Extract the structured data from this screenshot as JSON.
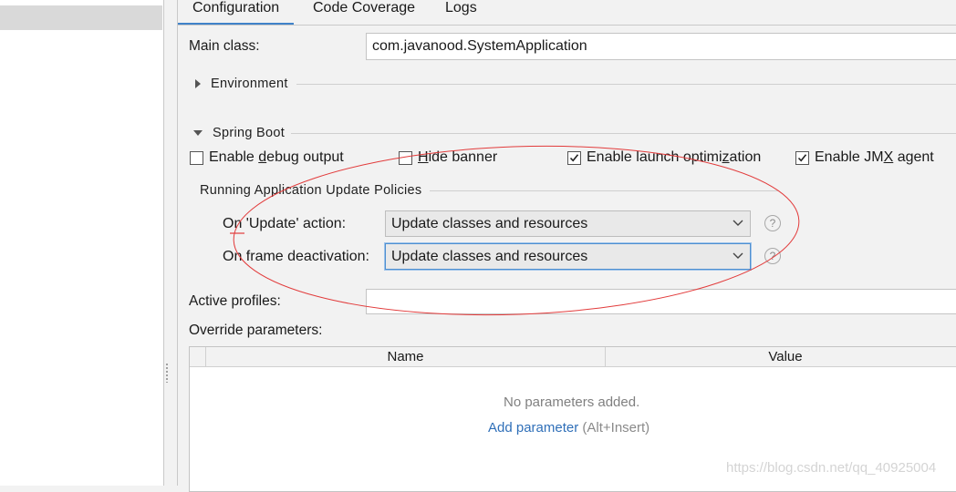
{
  "tabs": [
    {
      "label": "Configuration",
      "active": true
    },
    {
      "label": "Code Coverage",
      "active": false
    },
    {
      "label": "Logs",
      "active": false
    }
  ],
  "main_class": {
    "label": "Main class:",
    "value": "com.javanood.SystemApplication"
  },
  "environment": {
    "title": "Environment",
    "expanded": false
  },
  "spring_boot": {
    "title": "Spring Boot",
    "expanded": true,
    "checkboxes": [
      {
        "pre": "Enable ",
        "mnemonic": "d",
        "post": "ebug output",
        "checked": false
      },
      {
        "pre": "",
        "mnemonic": "H",
        "post": "ide banner",
        "checked": false
      },
      {
        "pre": "Enable launch optimi",
        "mnemonic": "z",
        "post": "ation",
        "checked": true
      },
      {
        "pre": "Enable JM",
        "mnemonic": "X",
        "post": " agent",
        "checked": true
      }
    ]
  },
  "update_policies": {
    "title": "Running Application Update Policies",
    "on_update": {
      "label": "On 'Update' action:",
      "value": "Update classes and resources"
    },
    "on_frame": {
      "label": "On frame deactivation:",
      "value": "Update classes and resources"
    }
  },
  "active_profiles": {
    "label": "Active profiles:",
    "value": ""
  },
  "override_params": {
    "label": "Override parameters:",
    "columns": [
      "Name",
      "Value"
    ],
    "empty_text": "No parameters added.",
    "add_link": "Add parameter",
    "add_shortcut": "(Alt+Insert)"
  },
  "watermark": "https://blog.csdn.net/qq_40925004",
  "colors": {
    "accent": "#4083c9",
    "annotation": "#e23b3b",
    "link": "#2f6fb8"
  },
  "icons": {
    "help": "question-circle-icon",
    "chevron": "chevron-down-icon",
    "check": "check-icon"
  }
}
